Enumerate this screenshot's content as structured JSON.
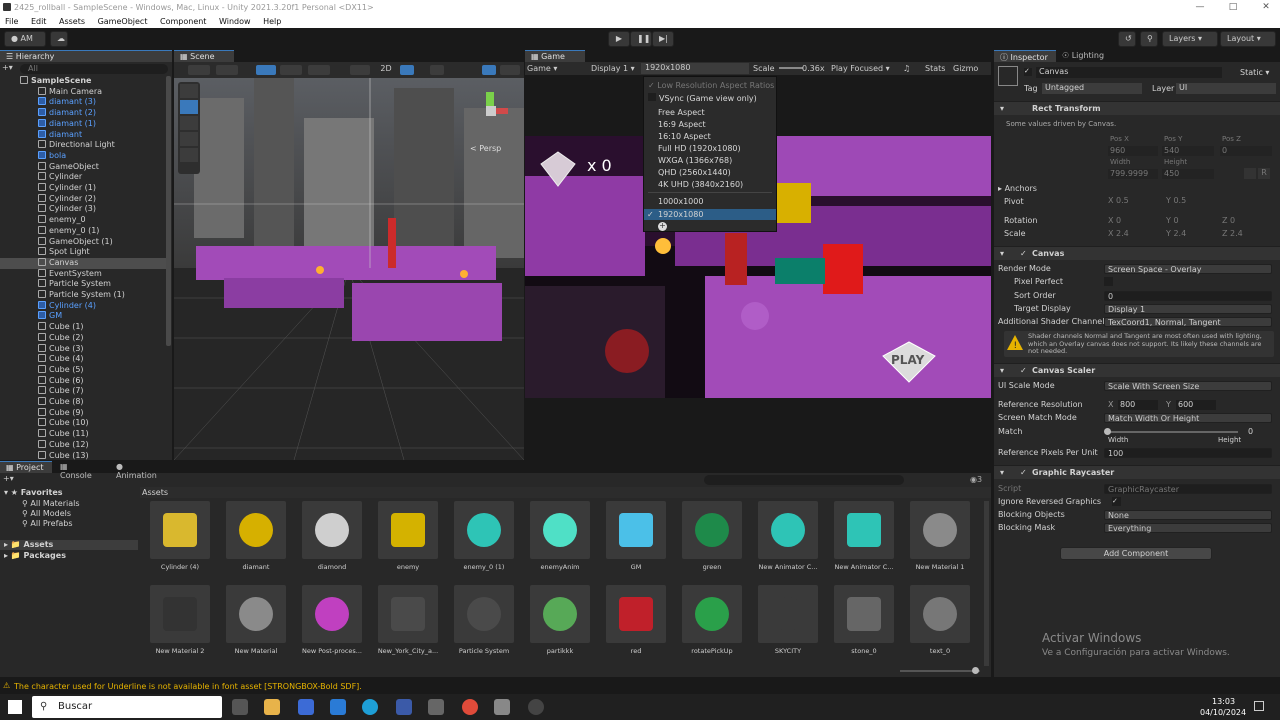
{
  "window": {
    "title": "2425_rollball - SampleScene - Windows, Mac, Linux - Unity 2021.3.20f1 Personal <DX11>"
  },
  "menu": [
    "File",
    "Edit",
    "Assets",
    "GameObject",
    "Component",
    "Window",
    "Help"
  ],
  "toolbar": {
    "account": "AM",
    "layers": "Layers",
    "layout": "Layout"
  },
  "hierarchy": {
    "tab": "Hierarchy",
    "search_placeholder": "All",
    "items": [
      {
        "label": "SampleScene",
        "depth": 0,
        "kind": "scene"
      },
      {
        "label": "Main Camera",
        "depth": 1,
        "kind": "obj"
      },
      {
        "label": "diamant (3)",
        "depth": 1,
        "kind": "prefab"
      },
      {
        "label": "diamant (2)",
        "depth": 1,
        "kind": "prefab"
      },
      {
        "label": "diamant (1)",
        "depth": 1,
        "kind": "prefab"
      },
      {
        "label": "diamant",
        "depth": 1,
        "kind": "prefab"
      },
      {
        "label": "Directional Light",
        "depth": 1,
        "kind": "obj"
      },
      {
        "label": "bola",
        "depth": 1,
        "kind": "prefab"
      },
      {
        "label": "GameObject",
        "depth": 1,
        "kind": "obj"
      },
      {
        "label": "Cylinder",
        "depth": 1,
        "kind": "obj"
      },
      {
        "label": "Cylinder (1)",
        "depth": 1,
        "kind": "obj"
      },
      {
        "label": "Cylinder (2)",
        "depth": 1,
        "kind": "obj"
      },
      {
        "label": "Cylinder (3)",
        "depth": 1,
        "kind": "obj"
      },
      {
        "label": "enemy_0",
        "depth": 1,
        "kind": "obj"
      },
      {
        "label": "enemy_0 (1)",
        "depth": 1,
        "kind": "obj"
      },
      {
        "label": "GameObject (1)",
        "depth": 1,
        "kind": "obj"
      },
      {
        "label": "Spot Light",
        "depth": 1,
        "kind": "obj"
      },
      {
        "label": "Canvas",
        "depth": 1,
        "kind": "obj",
        "selected": true
      },
      {
        "label": "EventSystem",
        "depth": 1,
        "kind": "obj"
      },
      {
        "label": "Particle System",
        "depth": 1,
        "kind": "obj"
      },
      {
        "label": "Particle System (1)",
        "depth": 1,
        "kind": "obj"
      },
      {
        "label": "Cylinder (4)",
        "depth": 1,
        "kind": "prefab"
      },
      {
        "label": "GM",
        "depth": 1,
        "kind": "prefab"
      },
      {
        "label": "Cube (1)",
        "depth": 1,
        "kind": "obj"
      },
      {
        "label": "Cube (2)",
        "depth": 1,
        "kind": "obj"
      },
      {
        "label": "Cube (3)",
        "depth": 1,
        "kind": "obj"
      },
      {
        "label": "Cube (4)",
        "depth": 1,
        "kind": "obj"
      },
      {
        "label": "Cube (5)",
        "depth": 1,
        "kind": "obj"
      },
      {
        "label": "Cube (6)",
        "depth": 1,
        "kind": "obj"
      },
      {
        "label": "Cube (7)",
        "depth": 1,
        "kind": "obj"
      },
      {
        "label": "Cube (8)",
        "depth": 1,
        "kind": "obj"
      },
      {
        "label": "Cube (9)",
        "depth": 1,
        "kind": "obj"
      },
      {
        "label": "Cube (10)",
        "depth": 1,
        "kind": "obj"
      },
      {
        "label": "Cube (11)",
        "depth": 1,
        "kind": "obj"
      },
      {
        "label": "Cube (12)",
        "depth": 1,
        "kind": "obj"
      },
      {
        "label": "Cube (13)",
        "depth": 1,
        "kind": "obj"
      }
    ]
  },
  "scene": {
    "tab": "Scene",
    "mode2d": "2D",
    "persp": "< Persp"
  },
  "game": {
    "tab": "Game",
    "mode": "Game",
    "display": "Display 1",
    "resolution": "1920x1080",
    "scale_label": "Scale",
    "scale_value": "0.36x",
    "play_mode": "Play Focused",
    "stats": "Stats",
    "gizmos": "Gizmo",
    "hud_count": "x 0",
    "play_text": "PLAY"
  },
  "resolution_menu": {
    "toggle_low": "Low Resolution Aspect Ratios",
    "toggle_vsync": "VSync (Game view only)",
    "options": [
      "Free Aspect",
      "16:9 Aspect",
      "16:10 Aspect",
      "Full HD (1920x1080)",
      "WXGA (1366x768)",
      "QHD (2560x1440)",
      "4K UHD (3840x2160)"
    ],
    "custom": [
      "1000x1000",
      "1920x1080"
    ],
    "selected": "1920x1080"
  },
  "inspector": {
    "tab": "Inspector",
    "tab2": "Lighting",
    "object_name": "Canvas",
    "static_label": "Static",
    "tag_label": "Tag",
    "tag_value": "Untagged",
    "layer_label": "Layer",
    "layer_value": "UI",
    "rect_transform": {
      "title": "Rect Transform",
      "note": "Some values driven by Canvas.",
      "pos_x_label": "Pos X",
      "pos_x": "960",
      "pos_y_label": "Pos Y",
      "pos_y": "540",
      "pos_z_label": "Pos Z",
      "pos_z": "0",
      "width_label": "Width",
      "width": "799.9999",
      "height_label": "Height",
      "height": "450",
      "anchors": "Anchors",
      "pivot": "Pivot",
      "pivot_x": "0.5",
      "pivot_y": "0.5",
      "rotation": "Rotation",
      "rot_x": "0",
      "rot_y": "0",
      "rot_z": "0",
      "scale": "Scale",
      "scale_x": "2.4",
      "scale_y": "2.4",
      "scale_z": "2.4"
    },
    "canvas": {
      "title": "Canvas",
      "render_mode_label": "Render Mode",
      "render_mode": "Screen Space - Overlay",
      "pixel_perfect": "Pixel Perfect",
      "sort_order_label": "Sort Order",
      "sort_order": "0",
      "target_display_label": "Target Display",
      "target_display": "Display 1",
      "shader_channels_label": "Additional Shader Channels",
      "shader_channels": "TexCoord1, Normal, Tangent",
      "warning": "Shader channels Normal and Tangent are most often used with lighting, which an Overlay canvas does not support. Its likely these channels are not needed."
    },
    "canvas_scaler": {
      "title": "Canvas Scaler",
      "ui_scale_label": "UI Scale Mode",
      "ui_scale": "Scale With Screen Size",
      "ref_res_label": "Reference Resolution",
      "ref_x": "800",
      "ref_y": "600",
      "match_mode_label": "Screen Match Mode",
      "match_mode": "Match Width Or Height",
      "match_label": "Match",
      "match_value": "0",
      "match_left": "Width",
      "match_right": "Height",
      "ppu_label": "Reference Pixels Per Unit",
      "ppu": "100"
    },
    "raycaster": {
      "title": "Graphic Raycaster",
      "script_label": "Script",
      "script": "GraphicRaycaster",
      "ignore_label": "Ignore Reversed Graphics",
      "blocking_obj_label": "Blocking Objects",
      "blocking_obj": "None",
      "blocking_mask_label": "Blocking Mask",
      "blocking_mask": "Everything"
    },
    "add_component": "Add Component"
  },
  "project": {
    "tabs": [
      "Project",
      "Console",
      "Animation"
    ],
    "favorites": "Favorites",
    "fav_items": [
      "All Materials",
      "All Models",
      "All Prefabs"
    ],
    "tree": [
      "Assets",
      "Packages"
    ],
    "breadcrumb": "Assets",
    "badge": "3",
    "assets_row1": [
      "Cylinder (4)",
      "diamant",
      "diamond",
      "enemy",
      "enemy_0 (1)",
      "enemyAnim",
      "GM",
      "green",
      "New Animator C...",
      "New Animator C...",
      "New Material 1"
    ],
    "assets_row2": [
      "New Material 2",
      "New Material",
      "New Post-proces...",
      "New_York_City_a...",
      "Particle System",
      "partikkk",
      "red",
      "rotatePickUp",
      "SKYCITY",
      "stone_0",
      "text_0"
    ]
  },
  "status": {
    "message": "The character used for Underline is not available in font asset [STRONGBOX-Bold SDF]."
  },
  "activation": {
    "title": "Activar Windows",
    "subtitle": "Ve a Configuración para activar Windows."
  },
  "taskbar": {
    "search": "Buscar",
    "time": "13:03",
    "date": "04/10/2024"
  },
  "colors": {
    "accent": "#3a79bb",
    "selection": "#2c5d87",
    "prefab": "#5aa0ff",
    "purple": "#b34fd1"
  }
}
